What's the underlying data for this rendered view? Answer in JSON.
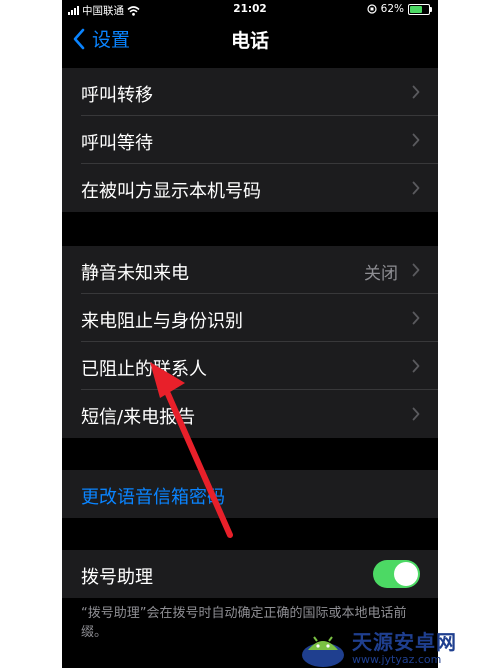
{
  "status": {
    "carrier": "中国联通",
    "time": "21:02",
    "battery": "62%",
    "battery_level": 0.62
  },
  "nav": {
    "back_label": "设置",
    "title": "电话"
  },
  "groups": [
    {
      "rows": [
        {
          "label": "呼叫转移"
        },
        {
          "label": "呼叫等待"
        },
        {
          "label": "在被叫方显示本机号码"
        }
      ]
    },
    {
      "rows": [
        {
          "label": "静音未知来电",
          "value": "关闭"
        },
        {
          "label": "来电阻止与身份识别"
        },
        {
          "label": "已阻止的联系人"
        },
        {
          "label": "短信/来电报告"
        }
      ]
    },
    {
      "rows": [
        {
          "label": "更改语音信箱密码"
        }
      ]
    },
    {
      "rows": [
        {
          "label": "拨号助理",
          "toggle_on": true
        }
      ]
    }
  ],
  "footer_note": "“拨号助理”会在拨号时自动确定正确的国际或本地电话前缀。",
  "colors": {
    "accent": "#0a84ff",
    "toggle_on": "#4cd964",
    "annotation_arrow": "#e8202a",
    "watermark": "#1f3f8f"
  },
  "watermark": {
    "name": "天源安卓网",
    "url": "www.jytyaz.com"
  }
}
